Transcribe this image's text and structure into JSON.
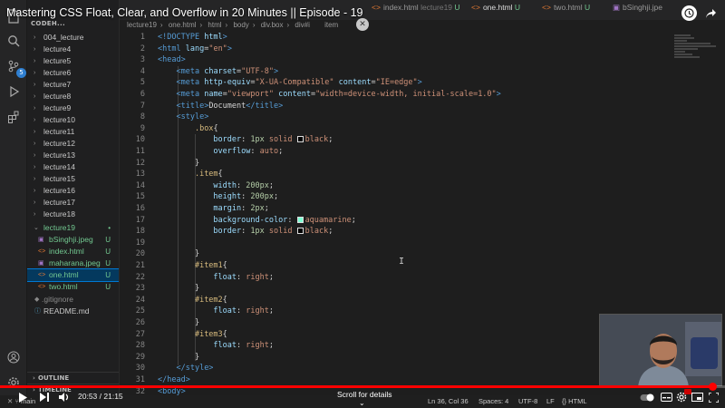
{
  "video": {
    "title": "Mastering CSS Float, Clear, and Overflow in 20 Minutes || Episode - 19",
    "time_current": "20:53",
    "time_total": "21:15",
    "progress": 0.983,
    "scroll_hint": "Scroll for details"
  },
  "sidebar": {
    "header": "CODEH...",
    "items": [
      {
        "label": "004_lecture",
        "type": "folder"
      },
      {
        "label": "lecture4",
        "type": "folder"
      },
      {
        "label": "lecture5",
        "type": "folder"
      },
      {
        "label": "lecture6",
        "type": "folder"
      },
      {
        "label": "lecture7",
        "type": "folder"
      },
      {
        "label": "lecture8",
        "type": "folder"
      },
      {
        "label": "lecture9",
        "type": "folder"
      },
      {
        "label": "lecture10",
        "type": "folder"
      },
      {
        "label": "lecture11",
        "type": "folder"
      },
      {
        "label": "lecture12",
        "type": "folder"
      },
      {
        "label": "lecture13",
        "type": "folder"
      },
      {
        "label": "lecture14",
        "type": "folder"
      },
      {
        "label": "lecture15",
        "type": "folder"
      },
      {
        "label": "lecture16",
        "type": "folder"
      },
      {
        "label": "lecture17",
        "type": "folder"
      },
      {
        "label": "lecture18",
        "type": "folder"
      },
      {
        "label": "lecture19",
        "type": "folder-open",
        "status": "•"
      },
      {
        "label": "bSinghji.jpeg",
        "type": "image",
        "status": "U"
      },
      {
        "label": "index.html",
        "type": "html",
        "status": "U"
      },
      {
        "label": "maharana.jpeg",
        "type": "image",
        "status": "U"
      },
      {
        "label": "one.html",
        "type": "html",
        "status": "U",
        "selected": true
      },
      {
        "label": "two.html",
        "type": "html",
        "status": "U"
      },
      {
        "label": ".gitignore",
        "type": "file"
      },
      {
        "label": "README.md",
        "type": "file"
      }
    ],
    "outline_label": "OUTLINE",
    "timeline_label": "TIMELINE"
  },
  "tabs": [
    {
      "label": "index.html",
      "path": "lecture19",
      "status": "U"
    },
    {
      "label": "one.html",
      "status": "U"
    },
    {
      "label": "two.html",
      "status": "U"
    },
    {
      "label": "bSinghji.jpe",
      "status": ""
    }
  ],
  "breadcrumb": [
    "lecture19",
    "one.html",
    "html",
    "body",
    "div.box",
    "div#i",
    "item"
  ],
  "code": {
    "line_numbers": [
      "1",
      "2",
      "3",
      "4",
      "5",
      "6",
      "7",
      "8",
      "9",
      "10",
      "11",
      "12",
      "13",
      "14",
      "15",
      "16",
      "17",
      "18",
      "19",
      "20",
      "21",
      "22",
      "23",
      "24",
      "25",
      "26",
      "27",
      "28",
      "29",
      "30",
      "31",
      "32"
    ],
    "lines": [
      "<!DOCTYPE html>",
      "<html lang=\"en\">",
      "<head>",
      "    <meta charset=\"UTF-8\">",
      "    <meta http-equiv=\"X-UA-Compatible\" content=\"IE=edge\">",
      "    <meta name=\"viewport\" content=\"width=device-width, initial-scale=1.0\">",
      "    <title>Document</title>",
      "    <style>",
      "        .box{",
      "            border: 1px solid black;",
      "            overflow: auto;",
      "        }",
      "        .item{",
      "            width: 200px;",
      "            height: 200px;",
      "            margin: 2px;",
      "            background-color: aquamarine;",
      "            border: 1px solid black;",
      "",
      "        }",
      "        #item1{",
      "            float: right;",
      "        }",
      "        #item2{",
      "            float: right;",
      "        }",
      "        #item3{",
      "            float: right;",
      "        }",
      "    </style>",
      "</head>",
      "<body>"
    ]
  },
  "statusbar": {
    "branch": "main",
    "position": "Ln 36, Col 36",
    "spaces": "Spaces: 4",
    "encoding": "UTF-8",
    "eol": "LF",
    "language": "HTML"
  },
  "colors": {
    "accent": "#0078d4",
    "progress": "#ff0000",
    "untracked": "#73c991",
    "aquamarine": "#7fffd4"
  }
}
